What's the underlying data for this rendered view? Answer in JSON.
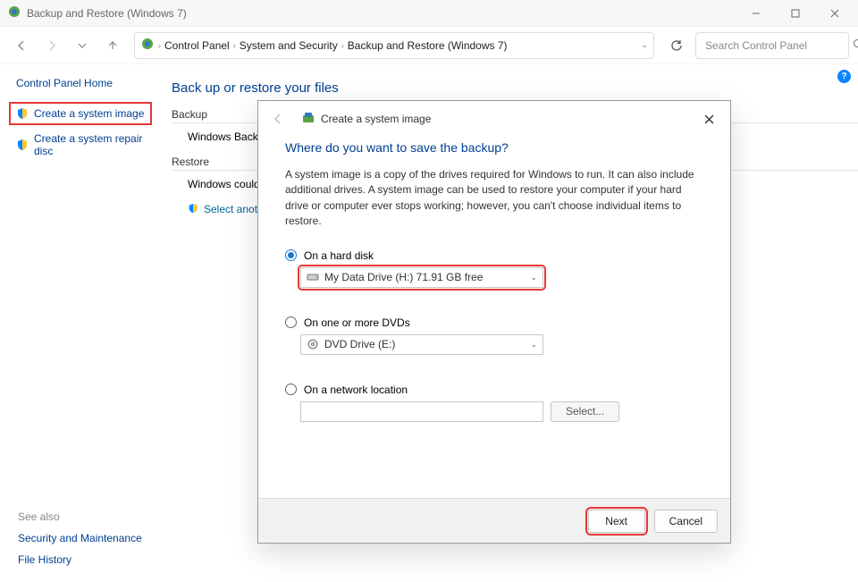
{
  "window": {
    "title": "Backup and Restore (Windows 7)"
  },
  "breadcrumb": {
    "items": [
      "Control Panel",
      "System and Security",
      "Backup and Restore (Windows 7)"
    ]
  },
  "search": {
    "placeholder": "Search Control Panel"
  },
  "sidebar": {
    "home": "Control Panel Home",
    "create_image": "Create a system image",
    "create_repair": "Create a system repair disc"
  },
  "main": {
    "heading": "Back up or restore your files",
    "backup_section": "Backup",
    "backup_line": "Windows Backup",
    "restore_section": "Restore",
    "restore_line": "Windows could n",
    "select_another": "Select another"
  },
  "seealso": {
    "label": "See also",
    "security": "Security and Maintenance",
    "filehistory": "File History"
  },
  "dialog": {
    "title": "Create a system image",
    "heading": "Where do you want to save the backup?",
    "description": "A system image is a copy of the drives required for Windows to run. It can also include additional drives. A system image can be used to restore your computer if your hard drive or computer ever stops working; however, you can't choose individual items to restore.",
    "opt_hard_disk": "On a hard disk",
    "hard_disk_value": "My Data Drive (H:)  71.91 GB free",
    "opt_dvd": "On one or more DVDs",
    "dvd_value": "DVD Drive (E:)",
    "opt_network": "On a network location",
    "select_btn": "Select...",
    "next": "Next",
    "cancel": "Cancel"
  }
}
